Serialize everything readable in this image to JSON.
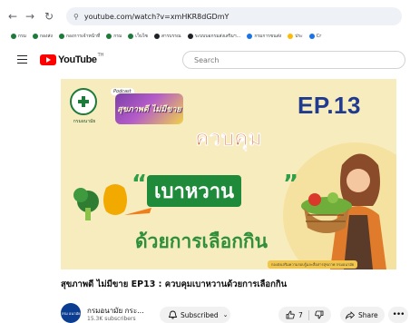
{
  "browser": {
    "url": "youtube.com/watch?v=xmHKR8dGDmY",
    "bookmarks": [
      {
        "label": "กรม",
        "color": "#1d7a3a"
      },
      {
        "label": "กองส่ง",
        "color": "#1d7a3a"
      },
      {
        "label": "กองการเจ้าหน้าที่",
        "color": "#1d7a3a"
      },
      {
        "label": "กรม",
        "color": "#1d7a3a"
      },
      {
        "label": "เว็บไซ",
        "color": "#1d7a3a"
      },
      {
        "label": "สารบรรณ",
        "color": "#202124"
      },
      {
        "label": "ระบบบอกรมส่งเสริมฯ...",
        "color": "#202124"
      },
      {
        "label": "กรมการขนส่ง",
        "color": "#1a73e8"
      },
      {
        "label": "ประ",
        "color": "#fbbc04"
      },
      {
        "label": "Cr",
        "color": "#1a73e8"
      }
    ]
  },
  "header": {
    "logo_word": "YouTube",
    "logo_sup": "TH",
    "search_placeholder": "Search"
  },
  "thumbnail": {
    "dept_caption": "กรมอนามัย",
    "podcast_tag": "Podcast",
    "brand": "สุขภาพดี ไม่มีขาย",
    "episode": "EP.13",
    "line1": "ควบคุม",
    "line2": "เบาหวาน",
    "line3": "ด้วยการเลือกกิน",
    "footnote": "กองส่งเสริมความรอบรู้และสื่อสารสุขภาพ กรมอนามัย"
  },
  "video": {
    "title": "สุขภาพดี ไม่มีขาย EP13 : ควบคุมเบาหวานด้วยการเลือกกิน",
    "channel_name": "กรมอนามัย กระ...",
    "subscribers": "15.3K subscribers",
    "avatar_text": "กรม อนามัย",
    "subscribed_label": "Subscribed",
    "like_count": "7",
    "share_label": "Share"
  },
  "colors": {
    "youtube_red": "#ff0000",
    "brand_green": "#1d7a3a",
    "episode_blue": "#1f3a8f",
    "headline_orange": "#d85a1d"
  }
}
